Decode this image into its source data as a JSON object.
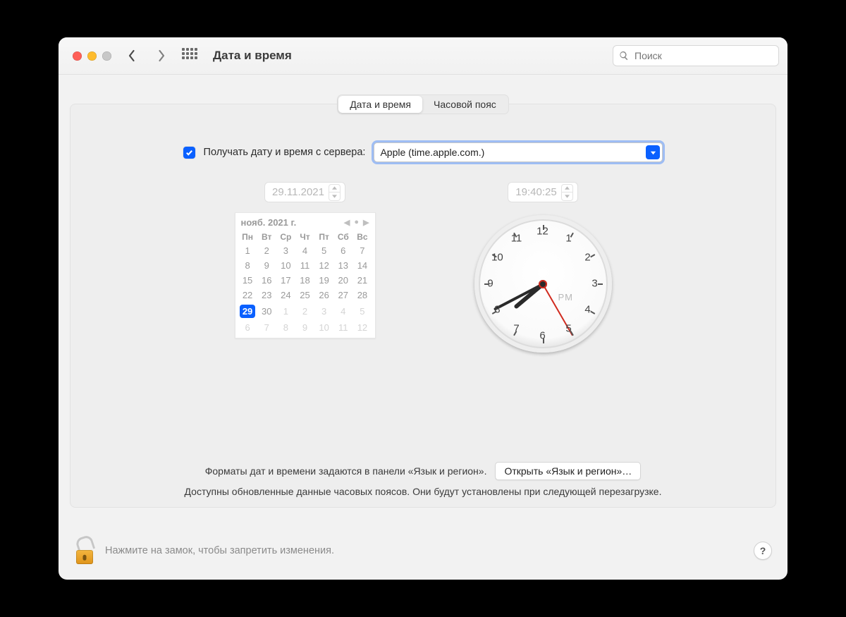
{
  "window": {
    "title": "Дата и время"
  },
  "search": {
    "placeholder": "Поиск"
  },
  "tabs": {
    "datetime": "Дата и время",
    "timezone": "Часовой пояс"
  },
  "auto": {
    "label": "Получать дату и время с сервера:",
    "server": "Apple (time.apple.com.)"
  },
  "date": {
    "value": "29.11.2021",
    "month_label": "нояб. 2021 г.",
    "weekdays": [
      "Пн",
      "Вт",
      "Ср",
      "Чт",
      "Пт",
      "Сб",
      "Вс"
    ],
    "weeks": [
      [
        {
          "d": "1"
        },
        {
          "d": "2"
        },
        {
          "d": "3"
        },
        {
          "d": "4"
        },
        {
          "d": "5"
        },
        {
          "d": "6"
        },
        {
          "d": "7"
        }
      ],
      [
        {
          "d": "8"
        },
        {
          "d": "9"
        },
        {
          "d": "10"
        },
        {
          "d": "11"
        },
        {
          "d": "12"
        },
        {
          "d": "13"
        },
        {
          "d": "14"
        }
      ],
      [
        {
          "d": "15"
        },
        {
          "d": "16"
        },
        {
          "d": "17"
        },
        {
          "d": "18"
        },
        {
          "d": "19"
        },
        {
          "d": "20"
        },
        {
          "d": "21"
        }
      ],
      [
        {
          "d": "22"
        },
        {
          "d": "23"
        },
        {
          "d": "24"
        },
        {
          "d": "25"
        },
        {
          "d": "26"
        },
        {
          "d": "27"
        },
        {
          "d": "28"
        }
      ],
      [
        {
          "d": "29",
          "sel": true
        },
        {
          "d": "30"
        },
        {
          "d": "1",
          "out": true
        },
        {
          "d": "2",
          "out": true
        },
        {
          "d": "3",
          "out": true
        },
        {
          "d": "4",
          "out": true
        },
        {
          "d": "5",
          "out": true
        }
      ],
      [
        {
          "d": "6",
          "out": true
        },
        {
          "d": "7",
          "out": true
        },
        {
          "d": "8",
          "out": true
        },
        {
          "d": "9",
          "out": true
        },
        {
          "d": "10",
          "out": true
        },
        {
          "d": "11",
          "out": true
        },
        {
          "d": "12",
          "out": true
        }
      ]
    ]
  },
  "time": {
    "value": "19:40:25",
    "ampm": "PM",
    "hour": 7,
    "minute": 40,
    "second": 25
  },
  "formats_hint": "Форматы дат и времени задаются в панели «Язык и регион».",
  "open_lang_region": "Открыть «Язык и регион»…",
  "tz_update_hint": "Доступны обновленные данные часовых поясов. Они будут установлены при следующей перезагрузке.",
  "lock_hint": "Нажмите на замок, чтобы запретить изменения.",
  "help": "?"
}
